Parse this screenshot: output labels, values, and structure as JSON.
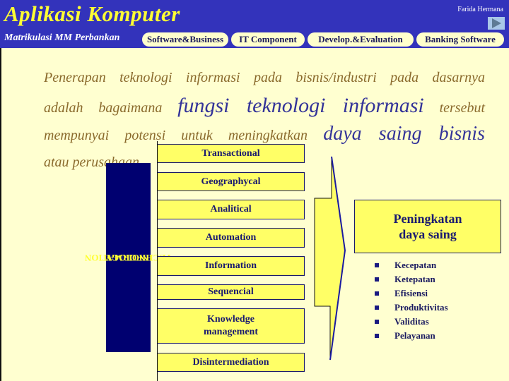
{
  "header": {
    "title": "Aplikasi Komputer",
    "subtitle": "Matrikulasi MM Perbankan",
    "author": "Farida Hermana",
    "next_icon": "play-triangle-icon"
  },
  "tabs": [
    {
      "label": "Software&Business"
    },
    {
      "label": "IT Component"
    },
    {
      "label": "Develop.&Evaluation"
    },
    {
      "label": "Banking Software"
    }
  ],
  "paragraph": {
    "line1": "Penerapan teknologi informasi pada bisnis/industri pada dasarnya",
    "line2_a": "adalah bagaimana",
    "line2_em": "fungsi teknologi informasi",
    "line2_b": "tersebut",
    "line3_a": "mempunyai potensi untuk  meningkatkan",
    "line3_em": "daya saing bisnis",
    "line4": "atau perusahaan"
  },
  "diagram": {
    "side_label_line1": "INFORMATION",
    "side_label_line2": "TECHNOLOGY",
    "functions": [
      "Transactional",
      "Geographycal",
      "Analitical",
      "Automation",
      "Information",
      "Sequencial",
      "Knowledge management",
      "Disintermediation"
    ],
    "result_line1": "Peningkatan",
    "result_line2": "daya saing",
    "benefits": [
      "Kecepatan",
      "Ketepatan",
      "Efisiensi",
      "Produktivitas",
      "Validitas",
      "Pelayanan"
    ]
  },
  "colors": {
    "header_bg": "#3333bb",
    "title": "#ffff33",
    "page_bg": "#ffffd0",
    "box_fill": "#ffff66",
    "navy": "#000070",
    "body_text": "#8a6a2c",
    "emphasis": "#333399"
  }
}
